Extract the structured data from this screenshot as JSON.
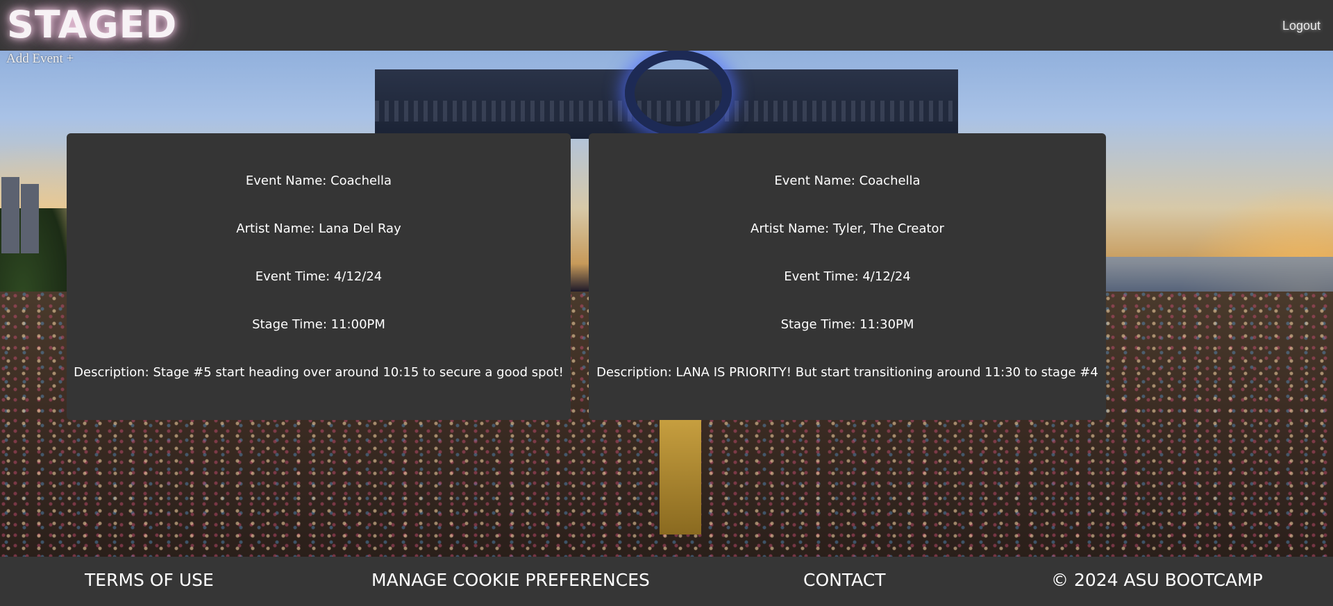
{
  "header": {
    "brand": "STAGED",
    "logout_label": "Logout"
  },
  "actions": {
    "add_event_label": "Add Event +"
  },
  "events": [
    {
      "event_name": "Event Name: Coachella",
      "artist_name": "Artist Name: Lana Del Ray",
      "event_time": "Event Time: 4/12/24",
      "stage_time": "Stage Time: 11:00PM",
      "description": "Description: Stage #5 start heading over around 10:15 to secure a good spot!"
    },
    {
      "event_name": "Event Name: Coachella",
      "artist_name": "Artist Name: Tyler, The Creator",
      "event_time": "Event Time: 4/12/24",
      "stage_time": "Stage Time: 11:30PM",
      "description": "Description: LANA IS PRIORITY! But start transitioning around 11:30 to stage #4"
    }
  ],
  "footer": {
    "terms": "TERMS OF USE",
    "cookies": "MANAGE COOKIE PREFERENCES",
    "contact": "CONTACT",
    "copyright": "© 2024 ASU BOOTCAMP"
  },
  "colors": {
    "bar_background": "#363636",
    "card_background": "#353535",
    "text": "#ffffff"
  }
}
